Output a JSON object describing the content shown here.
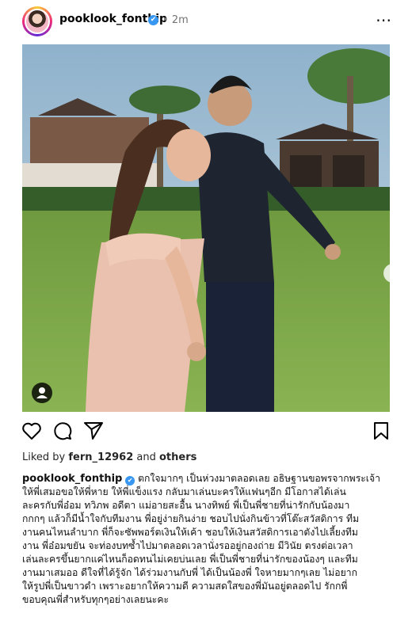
{
  "post": {
    "username": "pooklook_fonthip",
    "verified_badge": "✔",
    "separator": "•",
    "time_ago": "2m",
    "more_icon": "⋯"
  },
  "media": {
    "next_icon": "›",
    "slide_count": 10,
    "active_slide": 1,
    "user_tag_icon": "person-icon"
  },
  "actions": {
    "like_icon": "heart-outline-icon",
    "comment_icon": "comment-bubble-icon",
    "share_icon": "paper-plane-icon",
    "save_icon": "bookmark-icon"
  },
  "likes": {
    "prefix": "Liked by ",
    "user": "fern_12962",
    "middle": " and ",
    "suffix": "others"
  },
  "caption": {
    "username": "pooklook_fonthip",
    "lines": [
      " ตกใจมากๆ เป็นห่วงมาตลอดเลย อธิษฐานขอพรจากพระเจ้า",
      "ให้พี่เสมอขอให้พี่หาย ให้พี่แข็งแรง กลับมาเล่นบะครให้แฟนๆอีก มีโอกาสได้เล่น",
      "ละครกับพี่อ๋อม ทวิภพ อดีตา แม่อายสะอื้น นางทิพย์ พี่เป็นพี่ชายที่น่ารักกับน้องมา",
      "กกกๆ แล้วก็มีน้ำใจกับทีมงาน พี่อยู่ง่ายกินง่าย ชอบไปนั่งกินข้าวที่โต๊ะสวัสดิการ ทีม",
      "งานคนไหนลำบาก พี่ก็จะซัพพอร์ตเงินให้เค้า ชอบให้เงินสวัสดิการเอาตังไปเลี้ยงทีม",
      "งาน พี่อ๋อมขยัน จะท่องบทซ้ำไปมาตลอดเวลานั่งรออยู่กองถ่าย มีวินัย ตรงต่อเวลา",
      "เล่นละครขึ้นยากแค่ไหนก็อดทนไม่เคยบ่นเลย พี่เป็นพี่ชายที่น่ารักของน้องๆ และทีม",
      "งานมาเสมออ ดีใจที่ได้รู้จัก ได้ร่วมงานกับพี่ ได้เป็นน้องพี่ ใจหายมากๆเลย ไม่อยาก",
      "ให้รูปพี่เป็นขาวดำ เพราะอยากให้ความดี ความสดใสของพี่มันอยู่ตลอดไป รักกพี่",
      "ขอบคุณพี่สำหรับทุกๆอย่างเลยนะคะ"
    ]
  },
  "colors": {
    "verified": "#3897f0",
    "text_secondary": "#737373"
  }
}
